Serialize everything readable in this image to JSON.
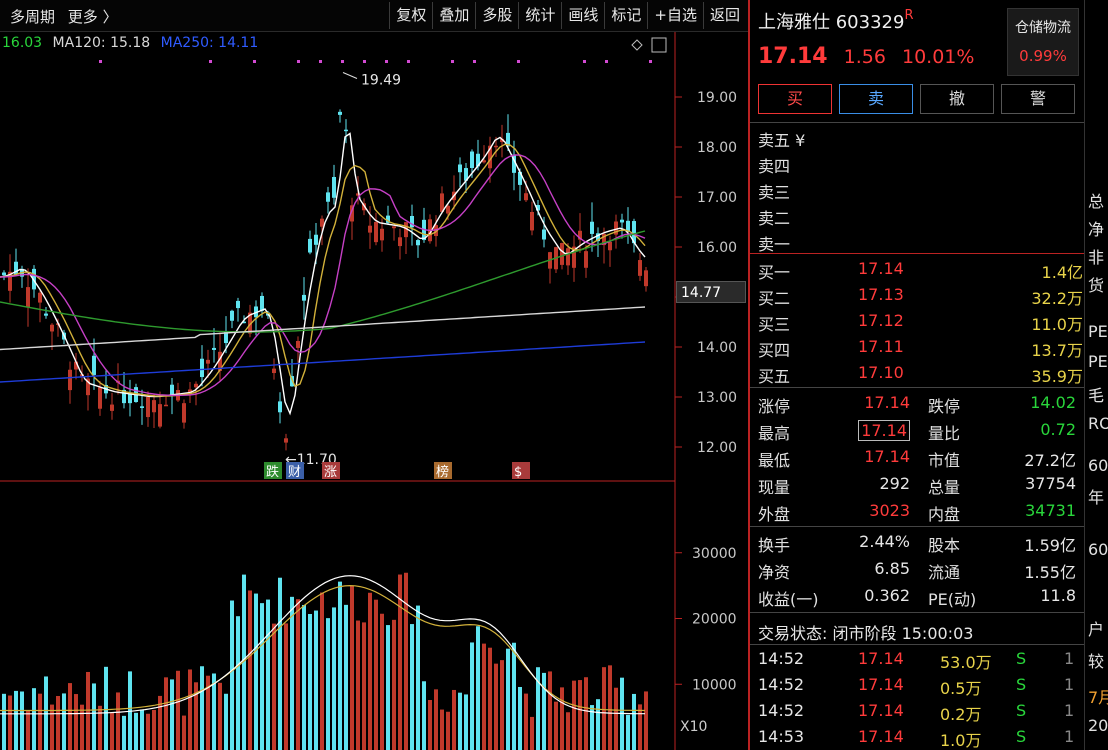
{
  "toolbar": {
    "period": "多周期",
    "more": "更多 〉",
    "buttons": [
      "复权",
      "叠加",
      "多股",
      "统计",
      "画线",
      "标记",
      "+自选",
      "返回"
    ]
  },
  "chart": {
    "legend": {
      "ma_first": "16.03",
      "ma120": "MA120: 15.18",
      "ma250": "MA250: 14.11"
    },
    "high_label": "19.49",
    "low_label": "11.70",
    "current_tag": "14.77",
    "x10_label": "X10",
    "event_tags": [
      "跌",
      "财",
      "涨",
      "榜",
      "$"
    ],
    "colors": {
      "up": "#c0392b",
      "down": "#5fe4f0",
      "ma5": "#ffffff",
      "ma10": "#d2b13a",
      "ma20": "#c640c6",
      "ma60": "#2e9a2e",
      "ma120": "#d8d8d8",
      "ma250": "#1e3cd8"
    }
  },
  "chart_data": {
    "type": "bar",
    "title": "",
    "price_axis": {
      "ticks": [
        19.0,
        18.0,
        17.0,
        16.0,
        15.0,
        14.0,
        13.0,
        12.0
      ],
      "range": [
        11.5,
        19.9
      ]
    },
    "volume_axis": {
      "ticks": [
        30000,
        20000,
        10000
      ],
      "range": [
        0,
        40000
      ]
    },
    "price_high": 19.49,
    "price_low": 11.7
  },
  "panel": {
    "name": "上海雅仕",
    "code": "603329",
    "flag": "R",
    "price": "17.14",
    "change": "1.56",
    "pct": "10.01%",
    "sector": {
      "title": "仓储物流",
      "value": "0.99%"
    },
    "actions": [
      "买",
      "卖",
      "撤",
      "警"
    ],
    "sell_orders": [
      {
        "label": "卖五 ¥",
        "price": "",
        "vol": ""
      },
      {
        "label": "卖四",
        "price": "",
        "vol": ""
      },
      {
        "label": "卖三",
        "price": "",
        "vol": ""
      },
      {
        "label": "卖二",
        "price": "",
        "vol": ""
      },
      {
        "label": "卖一",
        "price": "",
        "vol": ""
      }
    ],
    "buy_orders": [
      {
        "label": "买一",
        "price": "17.14",
        "vol": "1.4亿"
      },
      {
        "label": "买二",
        "price": "17.13",
        "vol": "32.2万"
      },
      {
        "label": "买三",
        "price": "17.12",
        "vol": "11.0万"
      },
      {
        "label": "买四",
        "price": "17.11",
        "vol": "13.7万"
      },
      {
        "label": "买五",
        "price": "17.10",
        "vol": "35.9万"
      }
    ],
    "stats": {
      "zt_k": "涨停",
      "zt_v": "17.14",
      "dt_k": "跌停",
      "dt_v": "14.02",
      "zg_k": "最高",
      "zg_v": "17.14",
      "lb_k": "量比",
      "lb_v": "0.72",
      "zd_k": "最低",
      "zd_v": "17.14",
      "sz_k": "市值",
      "sz_v": "27.2亿",
      "xl_k": "现量",
      "xl_v": "292",
      "zl_k": "总量",
      "zl_v": "37754",
      "wp_k": "外盘",
      "wp_v": "3023",
      "np_k": "内盘",
      "np_v": "34731",
      "hs_k": "换手",
      "hs_v": "2.44%",
      "gb_k": "股本",
      "gb_v": "1.59亿",
      "jz_k": "净资",
      "jz_v": "6.85",
      "lt_k": "流通",
      "lt_v": "1.55亿",
      "sy_k": "收益(一)",
      "sy_v": "0.362",
      "pe_k": "PE(动)",
      "pe_v": "11.8"
    },
    "status_label": "交易状态: 闭市阶段 15:00:03",
    "ticks": [
      {
        "time": "14:52",
        "price": "17.14",
        "vol": "53.0万",
        "side": "S",
        "n": "1"
      },
      {
        "time": "14:52",
        "price": "17.14",
        "vol": "0.5万",
        "side": "S",
        "n": "1"
      },
      {
        "time": "14:52",
        "price": "17.14",
        "vol": "0.2万",
        "side": "S",
        "n": "1"
      },
      {
        "time": "14:53",
        "price": "17.14",
        "vol": "1.0万",
        "side": "S",
        "n": "1"
      }
    ]
  },
  "farright": [
    "总",
    "净",
    "非",
    "货",
    "PE",
    "PE",
    "毛",
    "RO",
    "60",
    "年",
    "60",
    "户",
    "较",
    "7月",
    "20"
  ]
}
